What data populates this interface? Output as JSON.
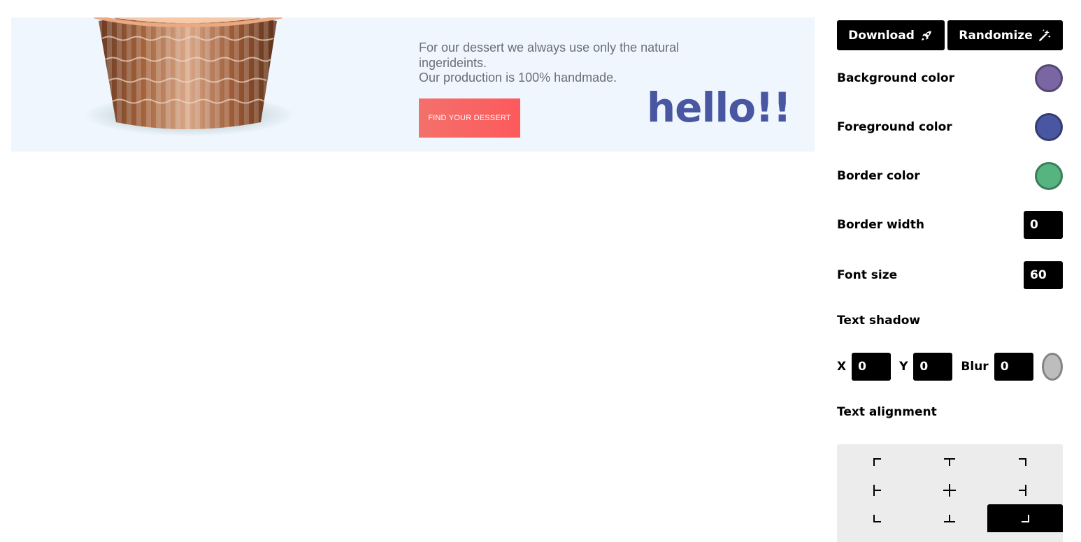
{
  "banner": {
    "copy_lines": [
      "For our dessert we always use only the natural",
      "ingerideints.",
      "Our production is 100% handmade."
    ],
    "cta_label": "FIND YOUR DESSERT",
    "headline": "hello!!",
    "headline_color": "#4957a3"
  },
  "toolbar": {
    "download_label": "Download",
    "download_icon": "rocket-icon",
    "randomize_label": "Randomize",
    "randomize_icon": "sparkles-icon"
  },
  "settings": {
    "background_color": {
      "label": "Background color",
      "value": "#7a66a3"
    },
    "foreground_color": {
      "label": "Foreground color",
      "value": "#4957a3"
    },
    "border_color": {
      "label": "Border color",
      "value": "#55b47f"
    },
    "border_width": {
      "label": "Border width",
      "value": "0"
    },
    "font_size": {
      "label": "Font size",
      "value": "60"
    },
    "text_shadow": {
      "label": "Text shadow",
      "x_label": "X",
      "x": "0",
      "y_label": "Y",
      "y": "0",
      "blur_label": "Blur",
      "blur": "0",
      "color": "#bdbdbd"
    },
    "text_alignment": {
      "label": "Text alignment",
      "options": [
        "top-left",
        "top-center",
        "top-right",
        "middle-left",
        "center",
        "middle-right",
        "bottom-left",
        "bottom-center",
        "bottom-right"
      ],
      "selected": "bottom-right"
    }
  }
}
